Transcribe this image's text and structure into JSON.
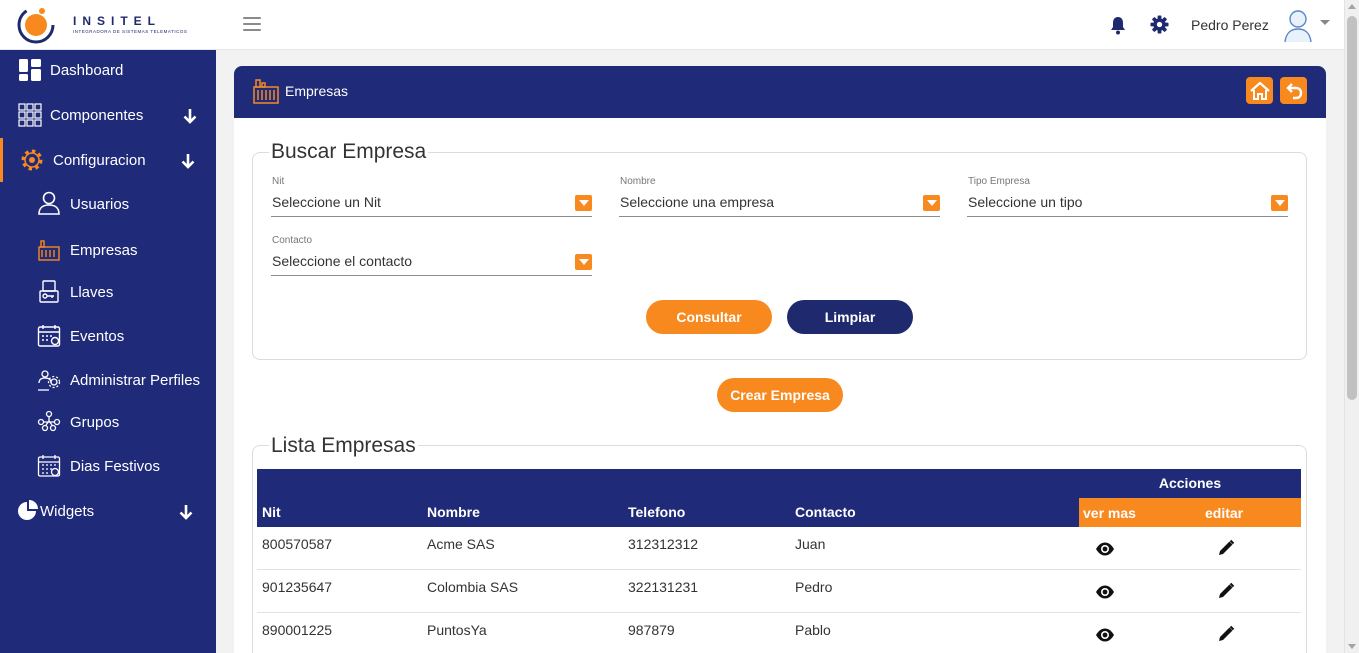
{
  "header": {
    "logo_text": "INSITEL",
    "logo_sub": "INTEGRADORA DE SISTEMAS TELEMATICOS",
    "user_name": "Pedro Perez"
  },
  "sidebar": {
    "items": [
      {
        "label": "Dashboard",
        "icon": "dashboard-icon"
      },
      {
        "label": "Componentes",
        "icon": "grid-icon"
      },
      {
        "label": "Configuracion",
        "icon": "gear-icon"
      },
      {
        "label": "Usuarios",
        "icon": "user-icon"
      },
      {
        "label": "Empresas",
        "icon": "factory-icon"
      },
      {
        "label": "Llaves",
        "icon": "keys-icon"
      },
      {
        "label": "Eventos",
        "icon": "calendar-icon"
      },
      {
        "label": "Administrar Perfiles",
        "icon": "profiles-icon"
      },
      {
        "label": "Grupos",
        "icon": "groups-icon"
      },
      {
        "label": "Dias Festivos",
        "icon": "holiday-calendar-icon"
      },
      {
        "label": "Widgets",
        "icon": "pie-chart-icon"
      }
    ]
  },
  "panel": {
    "title": "Empresas",
    "search": {
      "legend": "Buscar Empresa",
      "fields": [
        {
          "label": "Nit",
          "value": "Seleccione un Nit"
        },
        {
          "label": "Nombre",
          "value": "Seleccione una empresa"
        },
        {
          "label": "Tipo Empresa",
          "value": "Seleccione un tipo"
        },
        {
          "label": "Contacto",
          "value": "Seleccione el contacto"
        }
      ],
      "consult_label": "Consultar",
      "clear_label": "Limpiar"
    },
    "create_label": "Crear Empresa",
    "list": {
      "legend": "Lista Empresas",
      "columns": {
        "nit": "Nit",
        "nombre": "Nombre",
        "telefono": "Telefono",
        "contacto": "Contacto",
        "acciones": "Acciones",
        "ver_mas": "ver mas",
        "editar": "editar"
      },
      "rows": [
        {
          "nit": "800570587",
          "nombre": "Acme SAS",
          "telefono": "312312312",
          "contacto": "Juan"
        },
        {
          "nit": "901235647",
          "nombre": "Colombia SAS",
          "telefono": "322131231",
          "contacto": "Pedro"
        },
        {
          "nit": "890001225",
          "nombre": "PuntosYa",
          "telefono": "987879",
          "contacto": "Pablo"
        }
      ]
    }
  },
  "colors": {
    "navy": "#1f2a78",
    "orange": "#f7891f"
  }
}
